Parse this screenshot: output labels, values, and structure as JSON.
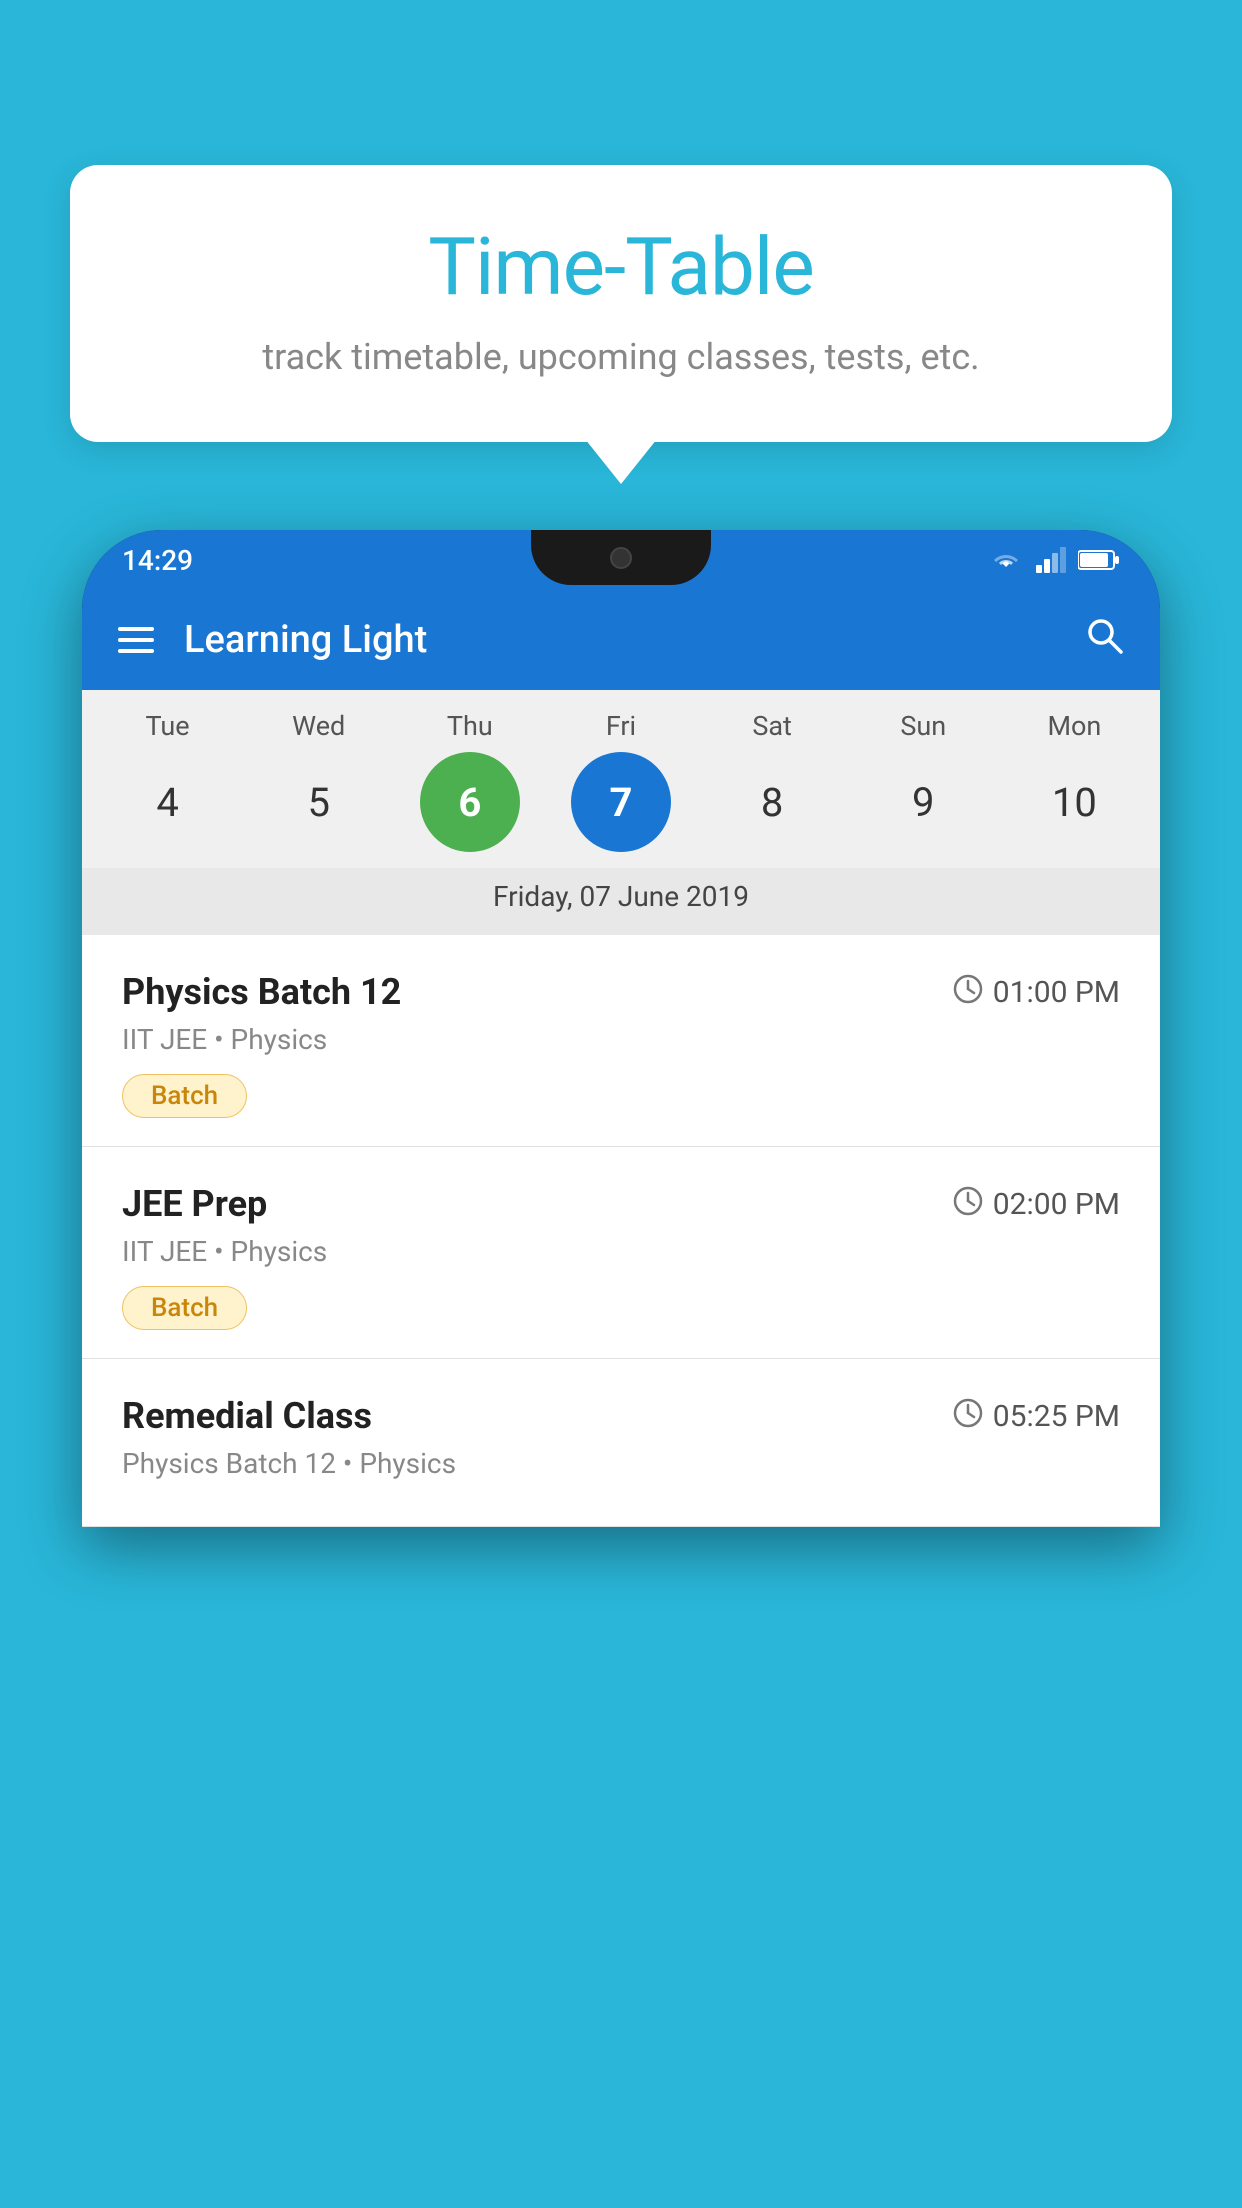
{
  "background_color": "#29B6D8",
  "tooltip": {
    "title": "Time-Table",
    "subtitle": "track timetable, upcoming classes, tests, etc."
  },
  "phone": {
    "status_bar": {
      "time": "14:29"
    },
    "app_bar": {
      "title": "Learning Light"
    },
    "calendar": {
      "days": [
        "Tue",
        "Wed",
        "Thu",
        "Fri",
        "Sat",
        "Sun",
        "Mon"
      ],
      "dates": [
        "4",
        "5",
        "6",
        "7",
        "8",
        "9",
        "10"
      ],
      "today_index": 2,
      "selected_index": 3,
      "selected_label": "Friday, 07 June 2019"
    },
    "schedule": [
      {
        "title": "Physics Batch 12",
        "time": "01:00 PM",
        "subtitle": "IIT JEE • Physics",
        "badge": "Batch"
      },
      {
        "title": "JEE Prep",
        "time": "02:00 PM",
        "subtitle": "IIT JEE • Physics",
        "badge": "Batch"
      },
      {
        "title": "Remedial Class",
        "time": "05:25 PM",
        "subtitle": "Physics Batch 12 • Physics",
        "badge": null
      }
    ]
  }
}
